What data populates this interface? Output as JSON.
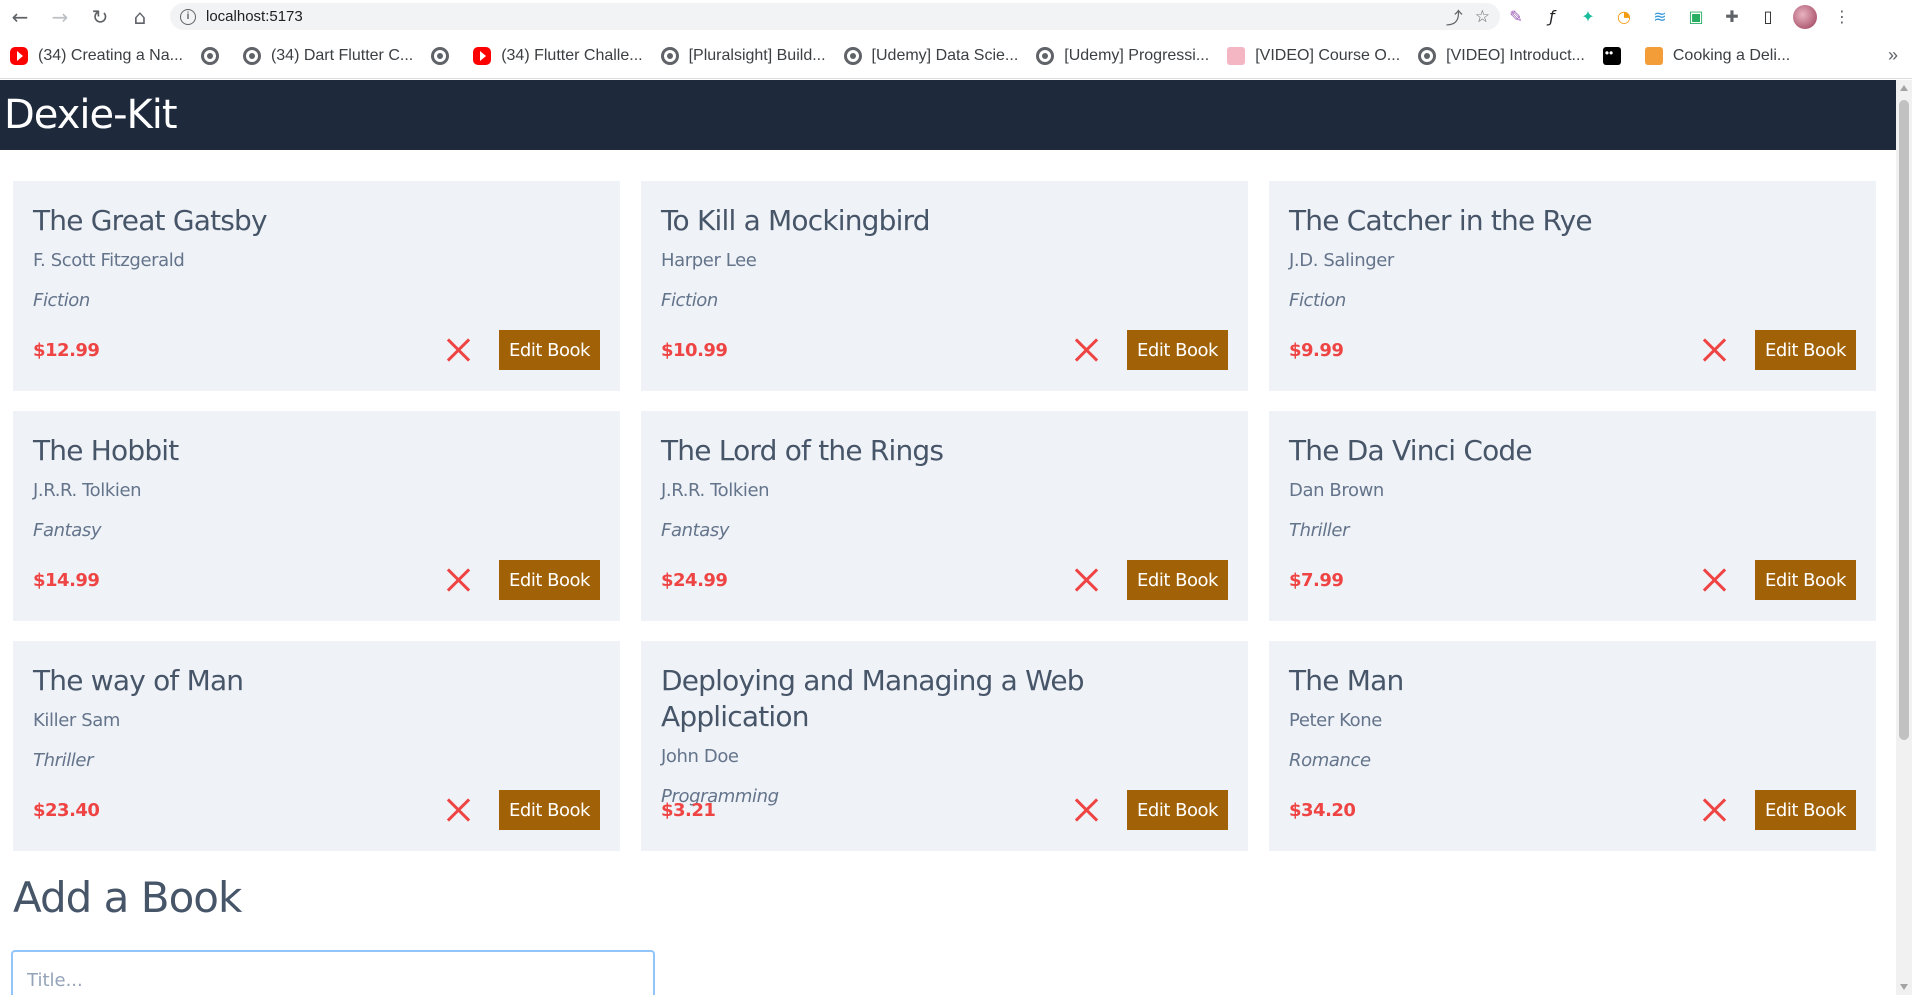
{
  "browser": {
    "url": "localhost:5173",
    "bookmarks": [
      {
        "label": "(34) Creating a Na...",
        "icon": "youtube-icon"
      },
      {
        "label": "",
        "icon": "globe-icon"
      },
      {
        "label": "(34) Dart Flutter C...",
        "icon": "globe-icon"
      },
      {
        "label": "",
        "icon": "globe-icon"
      },
      {
        "label": "(34) Flutter Challe...",
        "icon": "youtube-icon"
      },
      {
        "label": "[Pluralsight] Build...",
        "icon": "globe-icon"
      },
      {
        "label": "[Udemy] Data Scie...",
        "icon": "globe-icon"
      },
      {
        "label": "[Udemy] Progressi...",
        "icon": "globe-icon"
      },
      {
        "label": "[VIDEO] Course O...",
        "icon": "coffee-icon"
      },
      {
        "label": "[VIDEO] Introduct...",
        "icon": "globe-icon"
      },
      {
        "label": "",
        "icon": "medium-icon"
      },
      {
        "label": "Cooking a Deli...",
        "icon": "dish-icon"
      }
    ],
    "more_bookmarks": "»"
  },
  "app": {
    "title": "Dexie-Kit"
  },
  "books": [
    {
      "title": "The Great Gatsby",
      "author": "F. Scott Fitzgerald",
      "genre": "Fiction",
      "price": "$12.99",
      "edit_label": "Edit Book"
    },
    {
      "title": "To Kill a Mockingbird",
      "author": "Harper Lee",
      "genre": "Fiction",
      "price": "$10.99",
      "edit_label": "Edit Book"
    },
    {
      "title": "The Catcher in the Rye",
      "author": "J.D. Salinger",
      "genre": "Fiction",
      "price": "$9.99",
      "edit_label": "Edit Book"
    },
    {
      "title": "The Hobbit",
      "author": "J.R.R. Tolkien",
      "genre": "Fantasy",
      "price": "$14.99",
      "edit_label": "Edit Book"
    },
    {
      "title": "The Lord of the Rings",
      "author": "J.R.R. Tolkien",
      "genre": "Fantasy",
      "price": "$24.99",
      "edit_label": "Edit Book"
    },
    {
      "title": "The Da Vinci Code",
      "author": "Dan Brown",
      "genre": "Thriller",
      "price": "$7.99",
      "edit_label": "Edit Book"
    },
    {
      "title": "The way of Man",
      "author": "Killer Sam",
      "genre": "Thriller",
      "price": "$23.40",
      "edit_label": "Edit Book"
    },
    {
      "title": "Deploying and Managing a Web Application",
      "author": "John Doe",
      "genre": "Programming",
      "price": "$3.21",
      "edit_label": "Edit Book"
    },
    {
      "title": "The Man",
      "author": "Peter Kone",
      "genre": "Romance",
      "price": "$34.20",
      "edit_label": "Edit Book"
    }
  ],
  "add_form": {
    "heading": "Add a Book",
    "title_placeholder": "Title..."
  },
  "colors": {
    "header_bg": "#1e293b",
    "card_bg": "#eff2f7",
    "price": "#ef4444",
    "edit_button": "#a16207"
  }
}
